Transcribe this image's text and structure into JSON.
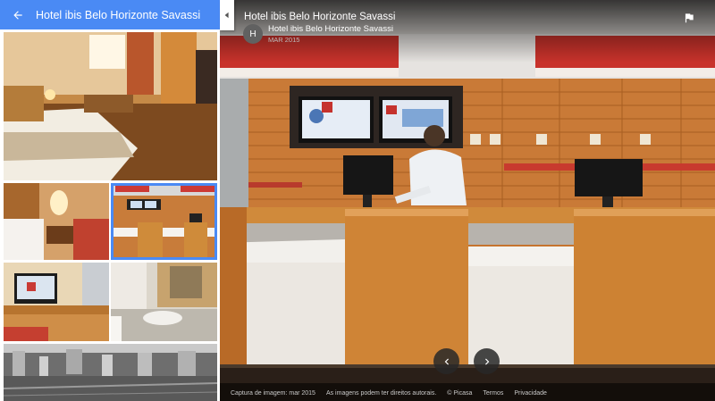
{
  "sidebar": {
    "title": "Hotel ibis Belo Horizonte Savassi",
    "back_icon": "arrow-back-icon",
    "photos": [
      {
        "name": "photo-bedroom",
        "selected": false
      },
      {
        "name": "photo-bedside-lamp",
        "selected": false
      },
      {
        "name": "photo-reception",
        "selected": true
      },
      {
        "name": "photo-desk-tv",
        "selected": false
      },
      {
        "name": "photo-bathroom-sink",
        "selected": false
      },
      {
        "name": "photo-city-aerial",
        "selected": false
      }
    ]
  },
  "viewer": {
    "title": "Hotel ibis Belo Horizonte Savassi",
    "avatar_letter": "H",
    "author": "Hotel ibis Belo Horizonte Savassi",
    "date": "MAR 2015",
    "flag_icon": "flag-icon",
    "prev_icon": "chevron-left-icon",
    "next_icon": "chevron-right-icon"
  },
  "footer": {
    "capture": "Captura de imagem: mar 2015",
    "rights": "As imagens podem ter direitos autorais.",
    "picasa": "© Picasa",
    "terms": "Termos",
    "privacy": "Privacidade"
  },
  "colors": {
    "header_blue": "#4a8af4",
    "wood": "#c9772f",
    "panel_red": "#c8322b"
  }
}
